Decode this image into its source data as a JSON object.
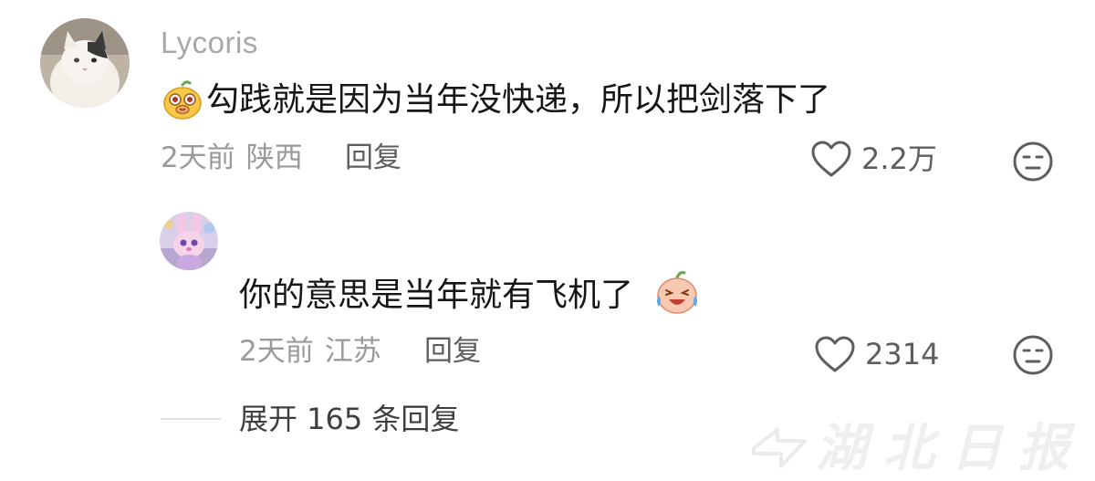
{
  "comment": {
    "username": "Lycoris",
    "text": "勾践就是因为当年没快递，所以把剑落下了",
    "time": "2天前",
    "location": "陕西",
    "reply_label": "回复",
    "likes": "2.2万",
    "avatar_icon": "cat-avatar",
    "emoji_icon": "bear-face-emoji"
  },
  "reply": {
    "text": "你的意思是当年就有飞机了",
    "time": "2天前",
    "location": "江苏",
    "reply_label": "回复",
    "likes": "2314",
    "avatar_icon": "bunny-plush-avatar",
    "emoji_icon": "crying-laughing-peach-emoji"
  },
  "expand_replies_label": "展开 165 条回复",
  "watermark": {
    "text": "湖北日报"
  },
  "colors": {
    "text_primary": "#161616",
    "text_secondary": "#9a9a9a",
    "text_action": "#5e5e5e",
    "username": "#a8a8a8"
  }
}
